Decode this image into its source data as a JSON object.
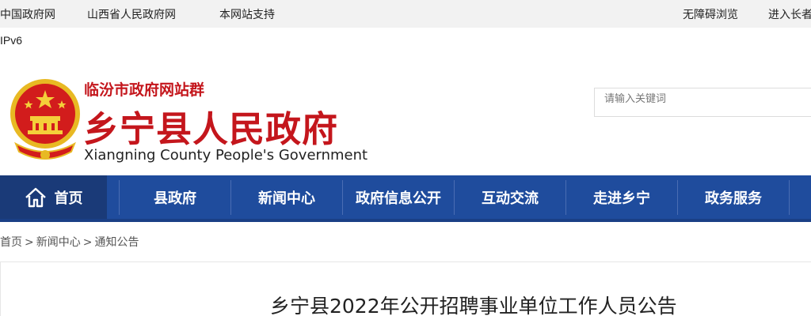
{
  "topbar": {
    "links": [
      "中国政府网",
      "山西省人民政府网",
      "本网站支持"
    ],
    "right_links": [
      "无障碍浏览",
      "进入长者"
    ]
  },
  "ipv6": "IPv6",
  "header": {
    "site_group": "临汾市政府网站群",
    "title": "乡宁县人民政府",
    "title_en": "Xiangning County People's Government",
    "brand_color": "#c4161c"
  },
  "search": {
    "placeholder": "请输入关键词"
  },
  "nav": {
    "items": [
      "首页",
      "县政府",
      "新闻中心",
      "政府信息公开",
      "互动交流",
      "走进乡宁",
      "政务服务"
    ],
    "bg_color": "#1f4c9d"
  },
  "breadcrumb": [
    "首页",
    "新闻中心",
    "通知公告"
  ],
  "article": {
    "title": "乡宁县2022年公开招聘事业单位工作人员公告"
  }
}
